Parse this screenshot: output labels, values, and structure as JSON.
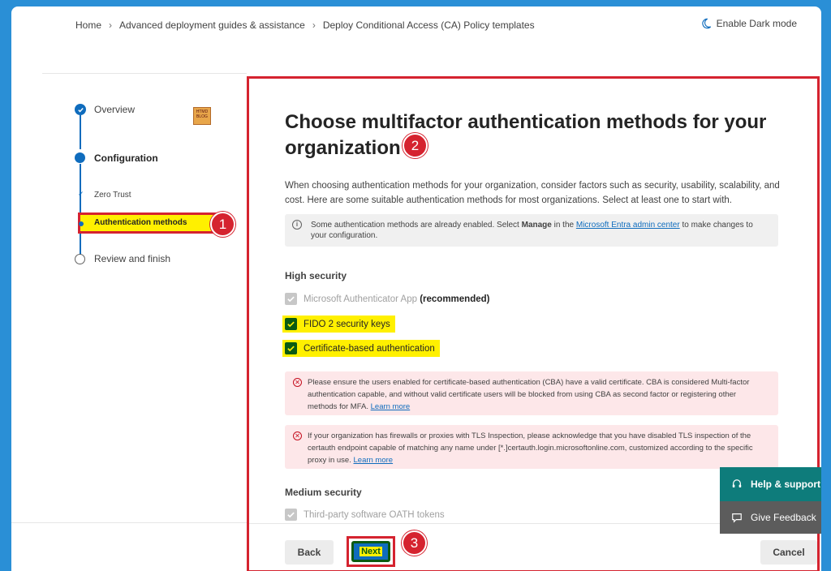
{
  "breadcrumb": [
    "Home",
    "Advanced deployment guides & assistance",
    "Deploy Conditional Access (CA) Policy templates"
  ],
  "dark_mode_label": "Enable Dark mode",
  "steps": {
    "overview": "Overview",
    "configuration": "Configuration",
    "zero_trust": "Zero Trust",
    "auth_methods": "Authentication methods",
    "review": "Review and finish"
  },
  "callouts": [
    "1",
    "2",
    "3"
  ],
  "main": {
    "title": "Choose multifactor authentication methods for your organization",
    "intro": "When choosing authentication methods for your organization, consider factors such as security, usability, scalability, and cost. Here are some suitable authentication methods for most organizations. Select at least one to start with.",
    "info_pre": "Some authentication methods are already enabled. Select ",
    "info_bold": "Manage",
    "info_mid": " in the ",
    "info_link": "Microsoft Entra admin center",
    "info_post": " to make changes to your configuration.",
    "high_security": "High security",
    "ms_auth_app": "Microsoft Authenticator App ",
    "ms_auth_recommended": "(recommended)",
    "fido": "FIDO 2 security keys",
    "cba": "Certificate-based authentication",
    "err1_text": "Please ensure the users enabled for certificate-based authentication (CBA) have a valid certificate. CBA is considered Multi-factor authentication capable, and without valid certificate users will be blocked from using CBA as second factor or registering other methods for MFA. ",
    "err1_link": "Learn more",
    "err2_text": "If your organization has firewalls or proxies with TLS Inspection, please acknowledge that you have disabled TLS inspection of the certauth endpoint capable of matching any name under [*.]certauth.login.microsoftonline.com, customized according to the specific proxy in use. ",
    "err2_link": "Learn more",
    "medium_security": "Medium security",
    "oath": "Third-party software OATH tokens"
  },
  "buttons": {
    "back": "Back",
    "next": "Next",
    "cancel": "Cancel"
  },
  "help": {
    "support": "Help & support",
    "feedback": "Give Feedback"
  },
  "logo_text": "HTMD BLOG",
  "colors": {
    "accent": "#0f6cbd",
    "annotation_red": "#d5232f",
    "highlight_yellow": "#fff000",
    "help_teal": "#0e7c7b"
  }
}
